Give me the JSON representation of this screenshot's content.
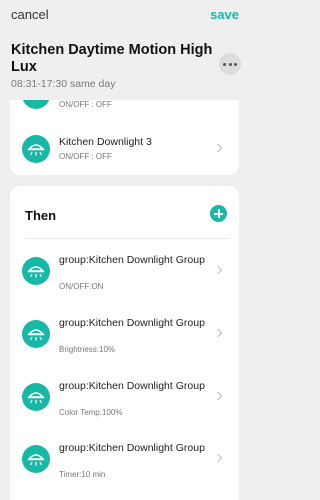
{
  "topbar": {
    "cancel_label": "cancel",
    "save_label": "save"
  },
  "scene": {
    "title": "Kitchen Daytime Motion High Lux",
    "time": "08:31-17:30 same day",
    "more_icon": "more-horizontal-icon"
  },
  "conditions": {
    "partial_status": "ON/OFF : OFF",
    "items": [
      {
        "name": "Kitchen Downlight 3",
        "status": "ON/OFF : OFF",
        "icon": "downlight-icon"
      }
    ]
  },
  "then": {
    "title": "Then",
    "add_icon": "plus-icon",
    "items": [
      {
        "name": "group:Kitchen Downlight Group",
        "detail": "ON/OFF:ON",
        "icon": "downlight-icon"
      },
      {
        "name": "group:Kitchen Downlight Group",
        "detail": "Brightness:10%",
        "icon": "downlight-icon"
      },
      {
        "name": "group:Kitchen Downlight Group",
        "detail": "Color Temp:100%",
        "icon": "downlight-icon"
      },
      {
        "name": "group:Kitchen Downlight Group",
        "detail": "Timer:10 min",
        "icon": "downlight-icon"
      }
    ]
  },
  "colors": {
    "accent": "#17b8a6",
    "background": "#efefef",
    "card": "#ffffff"
  }
}
